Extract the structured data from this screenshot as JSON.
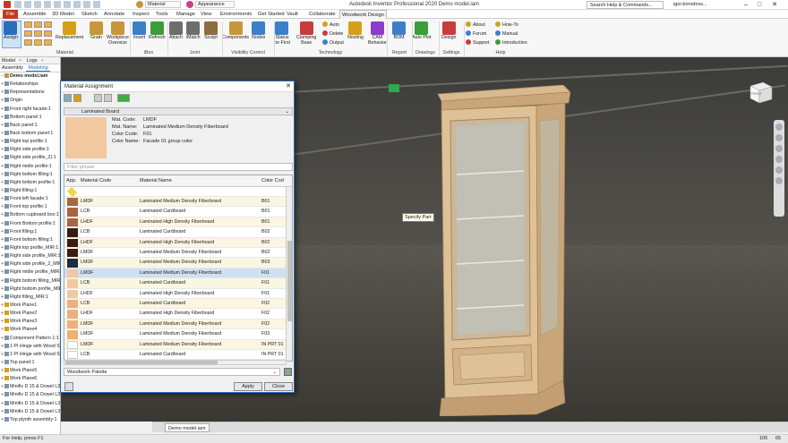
{
  "app": {
    "title": "Autodesk Inventor Professional 2020   Demo model.iam",
    "search_placeholder": "Search Help & Commands...",
    "user": "igor.borodovs...",
    "material_drop": "Material",
    "appearance_drop": "Appearance"
  },
  "tabs": [
    "File",
    "Assemble",
    "3D Model",
    "Sketch",
    "Annotate",
    "Inspect",
    "Tools",
    "Manage",
    "View",
    "Environments",
    "Get Started",
    "Vault",
    "Collaborate",
    "Woodwork Design"
  ],
  "ribbon": {
    "buttons": [
      {
        "label": "Assign",
        "color": "#2a6db8"
      },
      {
        "label": "Replacement",
        "color": "#d4a017"
      },
      {
        "label": "Grain",
        "color": "#c8963c"
      },
      {
        "label": "Workpiece\nOversize",
        "color": "#c8963c"
      },
      {
        "label": "Insert",
        "color": "#3c7fc8"
      },
      {
        "label": "Refresh",
        "color": "#3c9c3c"
      },
      {
        "label": "Attach",
        "color": "#6d6d6d"
      },
      {
        "label": "iMatch",
        "color": "#6d6d6d"
      },
      {
        "label": "Sculpt",
        "color": "#8c6d3c"
      },
      {
        "label": "Components",
        "color": "#c8963c"
      },
      {
        "label": "Nodes",
        "color": "#3c7fc8"
      },
      {
        "label": "Status\nfor First",
        "color": "#3c7fc8"
      },
      {
        "label": "Clamping\nBase",
        "color": "#c83c3c"
      },
      {
        "label": "Nesting",
        "color": "#d4a017"
      },
      {
        "label": "CAM\nBehavior",
        "color": "#8c3cc8"
      },
      {
        "label": "BOM",
        "color": "#3c7fc8"
      },
      {
        "label": "Auto Plot",
        "color": "#3c9c3c"
      },
      {
        "label": "Design",
        "color": "#c83c3c"
      }
    ],
    "small": [
      {
        "label": "Auto",
        "color": "#d4a017"
      },
      {
        "label": "Delete",
        "color": "#c83c3c"
      },
      {
        "label": "Output",
        "color": "#3c7fc8"
      },
      {
        "label": "About",
        "color": "#d4a017"
      },
      {
        "label": "Forum",
        "color": "#3c7fc8"
      },
      {
        "label": "Support",
        "color": "#c83c3c"
      },
      {
        "label": "How-To",
        "color": "#d4a017"
      },
      {
        "label": "Manual",
        "color": "#3c7fc8"
      },
      {
        "label": "Introduction",
        "color": "#3c9c3c"
      }
    ],
    "groups": [
      "Material",
      "iBox",
      "Joint",
      "Visibility Control",
      "Technology",
      "Report",
      "Drawings",
      "Settings",
      "Help"
    ]
  },
  "browser": {
    "tabs": [
      "Model",
      "Logs"
    ],
    "subtabs": [
      "Assembly",
      "Modeling"
    ],
    "items": [
      "Demo model.iam",
      "Relationships",
      "Representations",
      "Origin",
      "Front right facade:1",
      "Bottom panel:1",
      "Back panel:1",
      "Back bottom panel:1",
      "Right top profile:1",
      "Right side profile:1",
      "Right side profile_2):1",
      "Right midle profile:1",
      "Right bottom filling:1",
      "Right bottom profile:1",
      "Right filling:1",
      "Front left facade:1",
      "Front top profile:1",
      "Bottom cupboard box:1",
      "Front Bottom profile:1",
      "Front filling:1",
      "Front bottom filling:1",
      "Right top profile_MIR:1",
      "Right side profile_MIR:1",
      "Right side profile_2_MIR:1",
      "Right midle profile_MIR:1",
      "Right bottom filling_MIR:1",
      "Right bottom profile_MIR:1",
      "Right filling_MIR:1",
      "Work Plane1",
      "Work Plane2",
      "Work Plane3",
      "Work Plane4",
      "Component Pattern 1:1",
      "1 PI Hinge with Wood Screw:1",
      "1 PI Hinge with Wood Screw:2",
      "Top panel:1",
      "Work Plane5",
      "Work Plane6",
      "Minifix D 15 & Dowel L34 & Cap D15 PB T 18 LH:2",
      "Minifix D 15 & Dowel L34 & Cap D15 PB T 18 LH:3",
      "Minifix D 15 & Dowel L34 & Cap D15 PB T 18 LH:4",
      "Minifix D 15 & Dowel L34 & Cap D15 PB T 18 LH:5",
      "Top plynth assembly:1"
    ]
  },
  "viewport": {
    "doc_tab": "Demo model.iam",
    "tooltip": "Specify Part",
    "viewcube_label": "FRONT"
  },
  "dialog": {
    "title": "Material Assignment",
    "preset": "Laminated Board",
    "details": [
      {
        "k": "Mat. Code:",
        "v": "LMDF"
      },
      {
        "k": "Mat. Name:",
        "v": "Laminated Medium Density Fiberboard"
      },
      {
        "k": "Color Code:",
        "v": "F01"
      },
      {
        "k": "Color Name:",
        "v": "Facade 01 group color"
      }
    ],
    "filter_placeholder": "Filter phrase",
    "columns": [
      "App.",
      "Material Code",
      "Material Name",
      "Color Cod"
    ],
    "rows": [
      {
        "code": "LMDF",
        "name": "Laminated Medium Density Fiberboard",
        "color": "B01",
        "swatch": "#a86545"
      },
      {
        "code": "LCB",
        "name": "Laminated Cardboard",
        "color": "B01",
        "swatch": "#a86545"
      },
      {
        "code": "LHDF",
        "name": "Laminated High Density Fiberboard",
        "color": "B01",
        "swatch": "#a86545"
      },
      {
        "code": "LCB",
        "name": "Laminated Cardboard",
        "color": "B02",
        "swatch": "#3a1d12"
      },
      {
        "code": "LHDF",
        "name": "Laminated High Density Fiberboard",
        "color": "B02",
        "swatch": "#3a1d12"
      },
      {
        "code": "LMDF",
        "name": "Laminated Medium Density Fiberboard",
        "color": "B02",
        "swatch": "#3a1d12"
      },
      {
        "code": "LMDF",
        "name": "Laminated Medium Density Fiberboard",
        "color": "B03",
        "swatch": "#1f2c44"
      },
      {
        "code": "LMDF",
        "name": "Laminated Medium Density Fiberboard",
        "color": "F01",
        "swatch": "#f2c8a0"
      },
      {
        "code": "LCB",
        "name": "Laminated Cardboard",
        "color": "F01",
        "swatch": "#f2c8a0"
      },
      {
        "code": "LHDF",
        "name": "Laminated High Density Fiberboard",
        "color": "F01",
        "swatch": "#f2c8a0"
      },
      {
        "code": "LCB",
        "name": "Laminated Cardboard",
        "color": "F02",
        "swatch": "#ecb080"
      },
      {
        "code": "LHDF",
        "name": "Laminated High Density Fiberboard",
        "color": "F02",
        "swatch": "#ecb080"
      },
      {
        "code": "LMDF",
        "name": "Laminated Medium Density Fiberboard",
        "color": "F02",
        "swatch": "#ecb080"
      },
      {
        "code": "LMDF",
        "name": "Laminated Medium Density Fiberboard",
        "color": "F03",
        "swatch": "#f0b070"
      },
      {
        "code": "LMDF",
        "name": "Laminated Medium Density Fiberboard",
        "color": "IN PRT 01",
        "swatch": "#ffffff"
      },
      {
        "code": "LCB",
        "name": "Laminated Cardboard",
        "color": "IN PRT 01",
        "swatch": "#ffffff"
      }
    ],
    "palette": "Woodwork Palette",
    "apply": "Apply",
    "close": "Close"
  },
  "status": {
    "text": "For Help, press F1",
    "n1": "105",
    "n2": "65"
  }
}
